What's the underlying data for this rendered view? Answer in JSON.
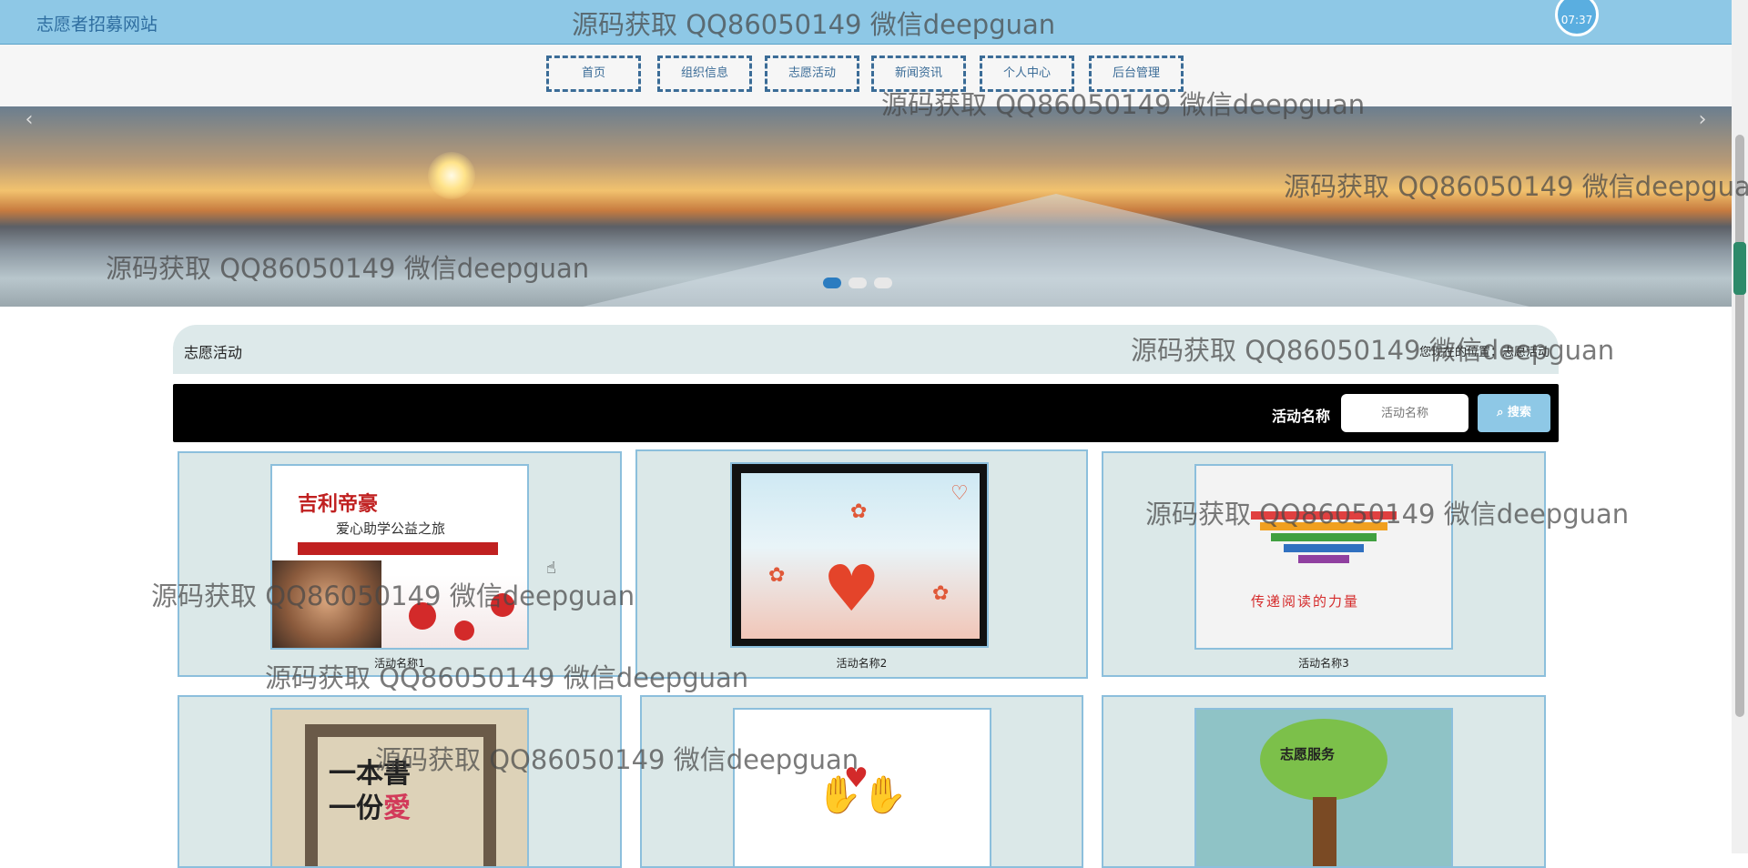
{
  "header": {
    "site_title": "志愿者招募网站",
    "clock": "07:37"
  },
  "nav": {
    "items": [
      "首页",
      "组织信息",
      "志愿活动",
      "新闻资讯",
      "个人中心",
      "后台管理"
    ]
  },
  "banner": {
    "slide_count": 3,
    "active_slide": 1,
    "prev_icon": "chevron-left-icon",
    "next_icon": "chevron-right-icon"
  },
  "section": {
    "title": "志愿活动",
    "breadcrumb": "您现在的位置：志愿活动"
  },
  "search": {
    "label": "活动名称",
    "placeholder": "活动名称",
    "button": "搜索",
    "button_icon": "search-icon"
  },
  "activities": [
    {
      "name": "活动名称1",
      "poster_title": "吉利帝豪",
      "poster_subtitle": "爱心助学公益之旅"
    },
    {
      "name": "活动名称2"
    },
    {
      "name": "活动名称3",
      "poster_text": "传递阅读的力量"
    },
    {
      "name": "",
      "poster_line1": "一本書",
      "poster_line2_a": "一份",
      "poster_line2_b": "愛"
    },
    {
      "name": ""
    },
    {
      "name": "",
      "poster_text": "志愿服务"
    }
  ],
  "watermark": "源码获取 QQ86050149 微信deepguan",
  "colors": {
    "topbar": "#8ec8e6",
    "nav_border": "#3b6c97",
    "card_bg": "#dbe8e8",
    "card_border": "#8cbfdc",
    "search_bar": "#000000",
    "active_dot": "#2b7cc0"
  }
}
